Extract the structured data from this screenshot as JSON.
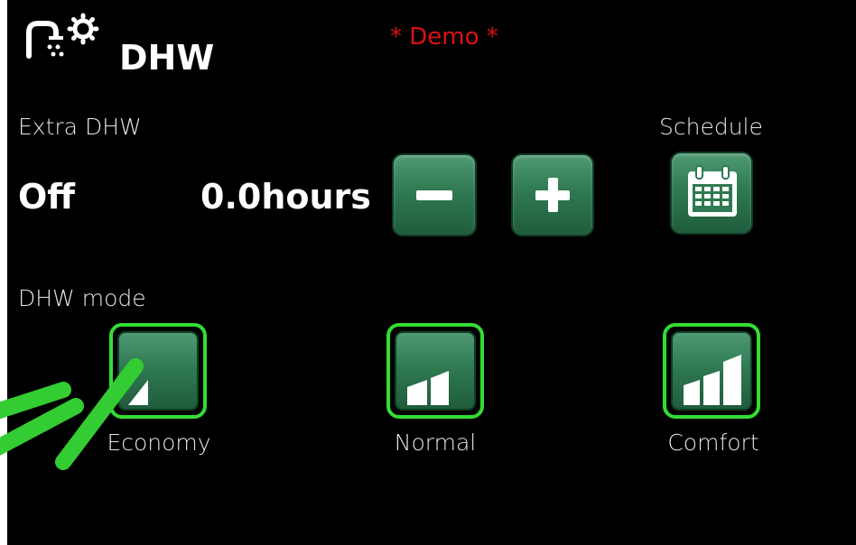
{
  "header": {
    "title": "DHW",
    "demo_label": "* Demo *",
    "icon": "shower-gear-icon"
  },
  "extra_dhw": {
    "label": "Extra DHW",
    "status": "Off",
    "duration": "0.0hours",
    "decrease_icon": "minus-icon",
    "increase_icon": "plus-icon"
  },
  "schedule": {
    "label": "Schedule",
    "icon": "calendar-icon"
  },
  "dhw_mode": {
    "label": "DHW mode",
    "modes": [
      {
        "label": "Economy",
        "icon": "level-1-bars-icon"
      },
      {
        "label": "Normal",
        "icon": "level-2-bars-icon"
      },
      {
        "label": "Comfort",
        "icon": "level-3-bars-icon"
      }
    ]
  },
  "colors": {
    "background": "#000000",
    "button": "#2f7a52",
    "selected_border": "#33dd33",
    "demo_text": "#dd1111",
    "annotation_arrow": "#33cc33"
  }
}
